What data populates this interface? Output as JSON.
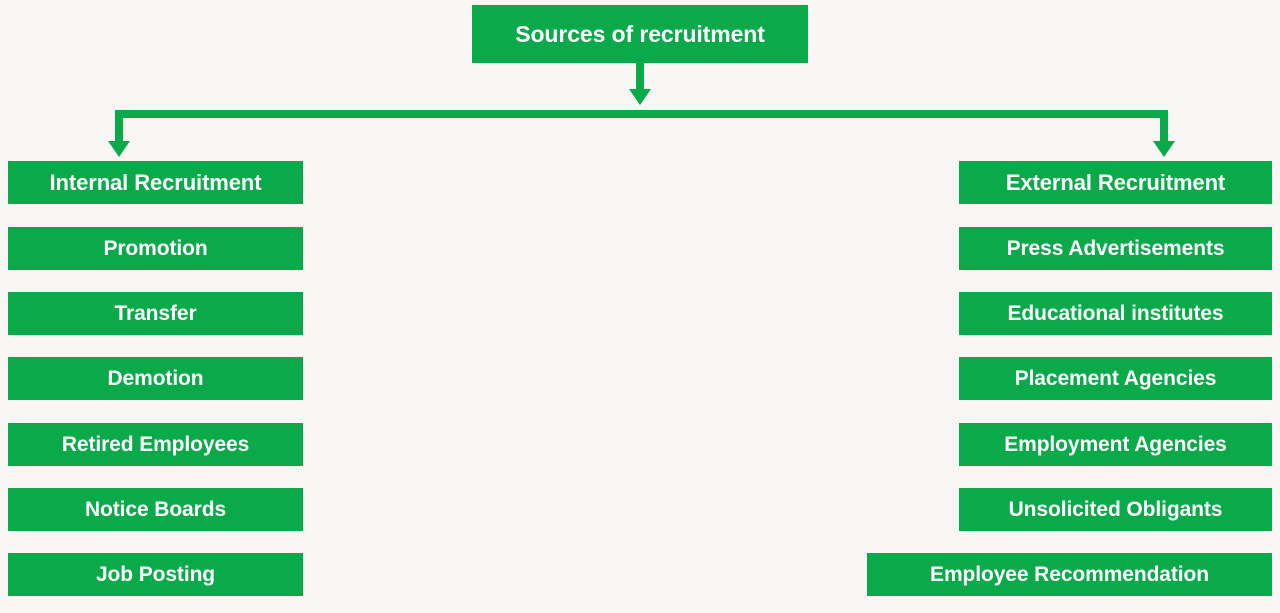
{
  "diagram": {
    "title": "Sources of recruitment",
    "colors": {
      "node_fill": "#0aa94a",
      "node_text": "#ffffff",
      "background": "#f7f6f5",
      "connector": "#0aa94a"
    },
    "branches": [
      {
        "heading": "Internal Recruitment",
        "items": [
          "Promotion",
          "Transfer",
          "Demotion",
          "Retired Employees",
          "Notice Boards",
          "Job Posting"
        ]
      },
      {
        "heading": "External Recruitment",
        "items": [
          "Press Advertisements",
          "Educational institutes",
          "Placement Agencies",
          "Employment Agencies",
          "Unsolicited Obligants",
          "Employee Recommendation"
        ]
      }
    ]
  }
}
